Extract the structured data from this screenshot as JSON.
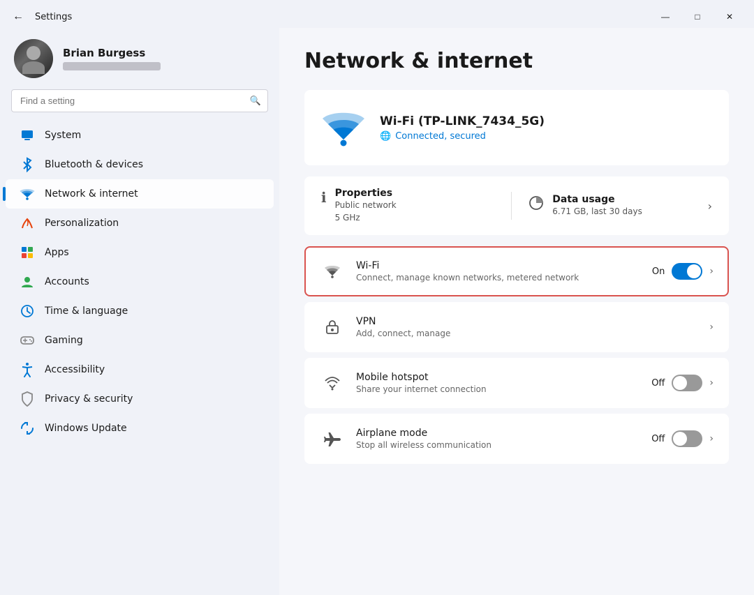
{
  "titlebar": {
    "back_label": "←",
    "title": "Settings",
    "minimize": "—",
    "maximize": "□",
    "close": "✕"
  },
  "sidebar": {
    "user": {
      "name": "Brian Burgess"
    },
    "search_placeholder": "Find a setting",
    "nav_items": [
      {
        "id": "system",
        "label": "System",
        "icon": "system"
      },
      {
        "id": "bluetooth",
        "label": "Bluetooth & devices",
        "icon": "bluetooth"
      },
      {
        "id": "network",
        "label": "Network & internet",
        "icon": "network",
        "active": true
      },
      {
        "id": "personalization",
        "label": "Personalization",
        "icon": "personalization"
      },
      {
        "id": "apps",
        "label": "Apps",
        "icon": "apps"
      },
      {
        "id": "accounts",
        "label": "Accounts",
        "icon": "accounts"
      },
      {
        "id": "time",
        "label": "Time & language",
        "icon": "time"
      },
      {
        "id": "gaming",
        "label": "Gaming",
        "icon": "gaming"
      },
      {
        "id": "accessibility",
        "label": "Accessibility",
        "icon": "accessibility"
      },
      {
        "id": "privacy",
        "label": "Privacy & security",
        "icon": "privacy"
      },
      {
        "id": "windows-update",
        "label": "Windows Update",
        "icon": "update"
      }
    ]
  },
  "main": {
    "page_title": "Network & internet",
    "hero": {
      "network_name": "Wi-Fi (TP-LINK_7434_5G)",
      "status": "Connected, secured"
    },
    "properties": {
      "label": "Properties",
      "line1": "Public network",
      "line2": "5 GHz"
    },
    "data_usage": {
      "label": "Data usage",
      "value": "6.71 GB, last 30 days"
    },
    "settings": [
      {
        "id": "wifi",
        "label": "Wi-Fi",
        "description": "Connect, manage known networks, metered network",
        "toggle": "On",
        "toggle_state": "on",
        "highlighted": true
      },
      {
        "id": "vpn",
        "label": "VPN",
        "description": "Add, connect, manage",
        "toggle": null,
        "toggle_state": null,
        "highlighted": false
      },
      {
        "id": "mobile-hotspot",
        "label": "Mobile hotspot",
        "description": "Share your internet connection",
        "toggle": "Off",
        "toggle_state": "off",
        "highlighted": false
      },
      {
        "id": "airplane-mode",
        "label": "Airplane mode",
        "description": "Stop all wireless communication",
        "toggle": "Off",
        "toggle_state": "off",
        "highlighted": false
      }
    ]
  },
  "icons": {
    "system": "🖥",
    "bluetooth": "🔵",
    "network": "🌐",
    "personalization": "🖌",
    "apps": "📦",
    "accounts": "👤",
    "time": "🌍",
    "gaming": "🎮",
    "accessibility": "♿",
    "privacy": "🛡",
    "update": "🔄"
  }
}
